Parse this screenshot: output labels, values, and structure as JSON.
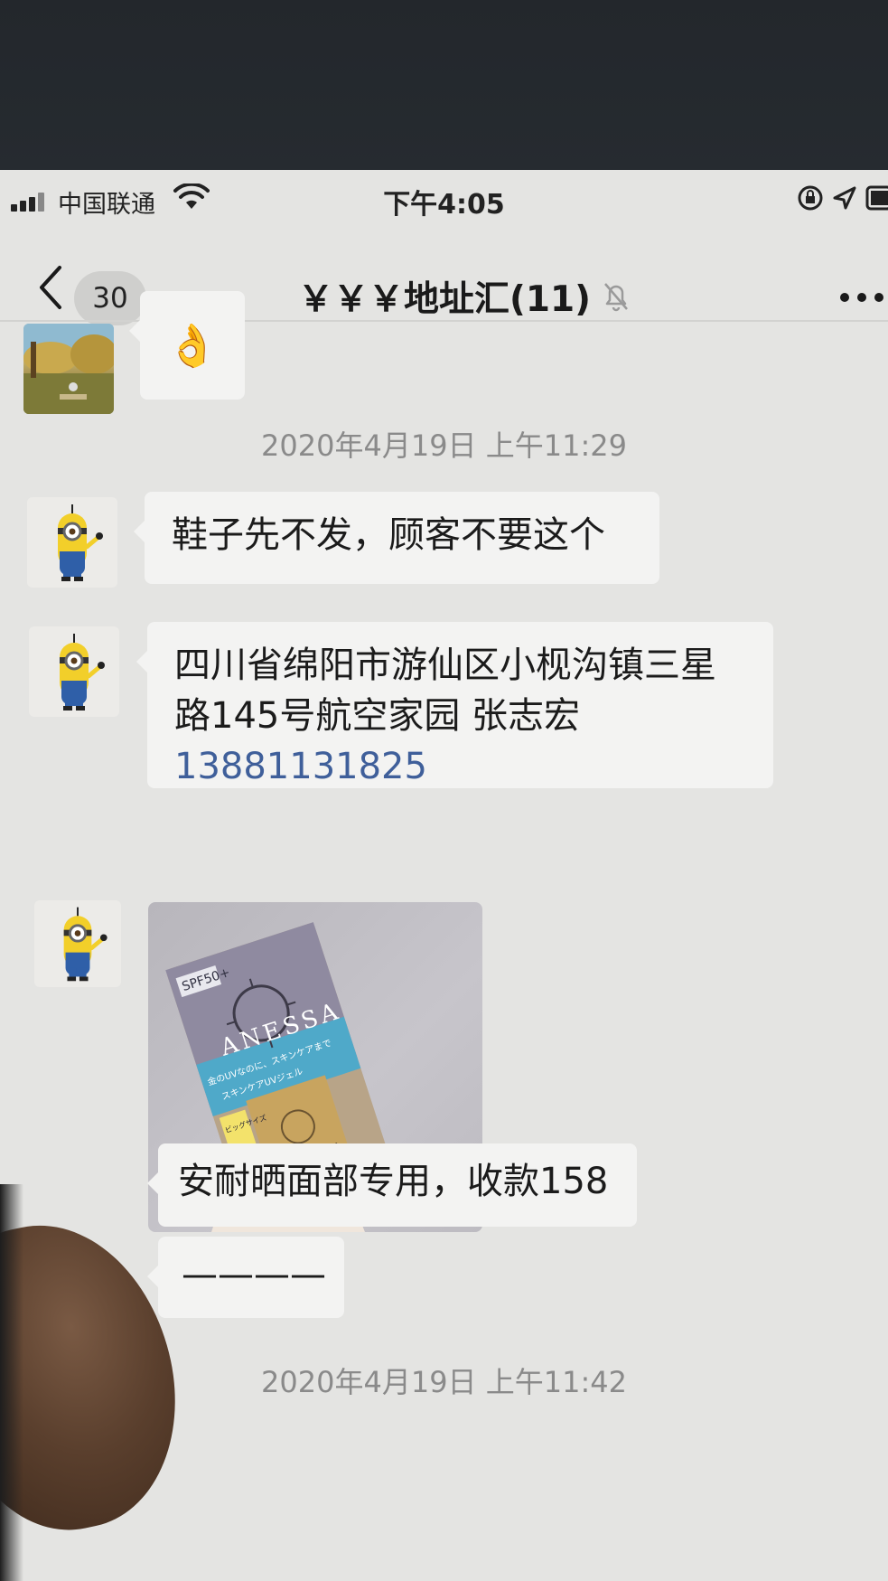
{
  "status_bar": {
    "carrier": "中国联通",
    "time": "下午4:05"
  },
  "nav": {
    "unread_count": "30",
    "chat_title": "￥￥￥地址汇(11)"
  },
  "messages": {
    "emoji": "👌",
    "timestamp_1": "2020年4月19日 上午11:29",
    "text_1": "鞋子先不发，顾客不要这个",
    "address_line": "四川省绵阳市游仙区小枧沟镇三星路145号航空家园 张志宏",
    "phone": "13881131825",
    "product_text": "安耐晒面部专用，收款158",
    "dash_text": "————",
    "timestamp_2": "2020年4月19日 上午11:42"
  },
  "photo": {
    "brand": "ANESSA",
    "spf": "SPF50+",
    "tagline": "金のUVなのに、スキンケアまで",
    "subline": "スキンケアUVジェル",
    "size_label": "ビッグサイズ"
  }
}
